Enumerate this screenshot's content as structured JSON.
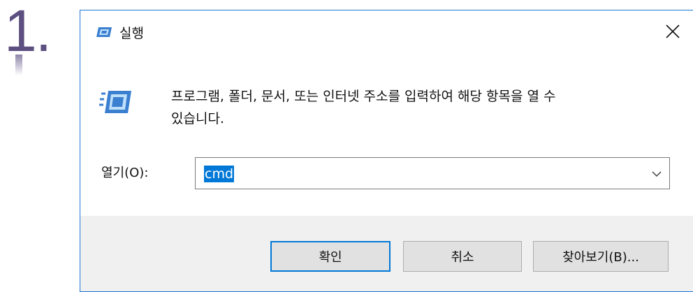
{
  "step": {
    "number": "1."
  },
  "dialog": {
    "title": "실행",
    "description_line1": "프로그램, 폴더, 문서, 또는 인터넷 주소를 입력하여 해당 항목을 열 수",
    "description_line2": "있습니다.",
    "open_label": "열기(O):",
    "open_value": "cmd",
    "buttons": {
      "ok": "확인",
      "cancel": "취소",
      "browse": "찾아보기(B)..."
    }
  },
  "icons": {
    "title": "run-icon",
    "body": "run-icon",
    "close": "close-icon",
    "dropdown": "chevron-down-icon"
  },
  "colors": {
    "accent": "#0078d7",
    "dialog_border": "#1e78d6",
    "footer_bg": "#f0f0f0",
    "step_number": "#5d4f80"
  }
}
